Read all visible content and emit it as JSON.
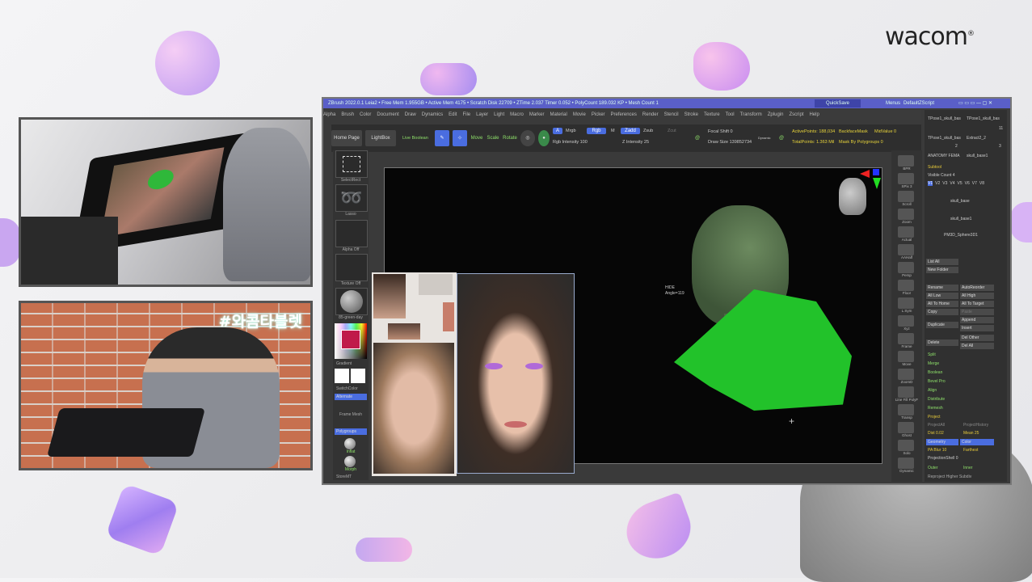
{
  "brand": {
    "name": "wacom",
    "mark": "®"
  },
  "stream": {
    "hashtag": "#와콤타블렛"
  },
  "zbrush": {
    "title": "ZBrush 2022.0.1   Leia2   • Free Mem 1.955GB • Active Mem 4175 • Scratch Disk 22709 • ZTime 2.037 Timer 0.052 • PolyCount 189.032 KP • Mesh Count 1",
    "quicksave": "QuickSave",
    "menus_label": "Menus",
    "default_script": "DefaultZScript",
    "menu": [
      "Alpha",
      "Brush",
      "Color",
      "Document",
      "Draw",
      "Dynamics",
      "Edit",
      "File",
      "Layer",
      "Light",
      "Macro",
      "Marker",
      "Material",
      "Movie",
      "Picker",
      "Preferences",
      "Render",
      "Stencil",
      "Stroke",
      "Texture",
      "Tool",
      "Transform",
      "Zplugin",
      "Zscript",
      "Help"
    ],
    "toolbar": {
      "home_page": "Home Page",
      "lightbox": "LightBox",
      "live_boolean": "Live Boolean",
      "draw": "Draw",
      "move": "Move",
      "scale": "Scale",
      "rotate": "Rotate",
      "a": "A",
      "mrgb": "Mrgb",
      "rgb": "Rgb",
      "m": "M",
      "zadd": "Zadd",
      "zsub": "Zsub",
      "zcut": "Zcut",
      "rgb_intensity": "Rgb Intensity 100",
      "z_intensity": "Z Intensity 25",
      "focal_shift": "Focal Shift 0",
      "draw_size": "Draw Size 139852734",
      "dynamic": "Dynamic",
      "active_points": "ActivePoints: 188,034",
      "total_points": "TotalPoints: 1.363 Mil",
      "backface_mask": "BackfaceMask",
      "midvalue": "MidValue 0",
      "mask_by_polygroups": "Mask By Polygroups 0"
    },
    "left_shelf": [
      "SelectRect",
      "Lasso",
      "Alpha Off",
      "Texture Off",
      "85-green-day",
      "Gradient",
      "SwitchColor",
      "Alternate",
      "Frame Mesh",
      "Polygroups",
      "Inflat",
      "Morph",
      "StoreMT"
    ],
    "canvas": {
      "hud_line1": "HIDE",
      "hud_line2": "Angle=119"
    },
    "right_shelf": [
      "BPR",
      "SPix 3",
      "Scroll",
      "Zoom",
      "Actual",
      "AAHalf",
      "Persp",
      "Floor",
      "L.Sym",
      "Xyz",
      "Frame",
      "Move",
      "ZoomD",
      "Line Fill PolyF",
      "Transp",
      "Ghost",
      "Solo",
      "Dynamic"
    ],
    "tray": {
      "tools": [
        "TPose1_skull_bas",
        "TPose1_skull_bas",
        "TPose1_skull_bas",
        "Extract2_2",
        "ANATOMY FEMA",
        "skull_base1"
      ],
      "counts": [
        "11",
        "2",
        "3"
      ],
      "subtool": "Subtool",
      "visible_count": "Visible Count 4",
      "v_tabs": [
        "V1",
        "V2",
        "V3",
        "V4",
        "V5",
        "V6",
        "V7",
        "V8"
      ],
      "subtools": [
        "skull_base",
        "skull_base1",
        "PM3D_Sphere3D1"
      ],
      "list_all": "List All",
      "new_folder": "New Folder",
      "rename": "Rename",
      "auto_reorder": "AutoReorder",
      "all_low": "All Low",
      "all_high": "All High",
      "all_to_home": "All To Home",
      "all_to_target": "All To Target",
      "copy": "Copy",
      "paste": "Paste",
      "duplicate": "Duplicate",
      "append": "Append",
      "insert": "Insert",
      "delete": "Delete",
      "del_other": "Del Other",
      "del_all": "Del All",
      "split": "Split",
      "merge": "Merge",
      "boolean": "Boolean",
      "bevel_pro": "Bevel Pro",
      "align": "Align",
      "distribute": "Distribute",
      "remesh": "Remesh",
      "project": "Project",
      "project_all": "ProjectAll",
      "project_history": "ProjectHistory",
      "dist": "Dist 0.02",
      "mean": "Mean 25",
      "geometry": "Geometry",
      "color": "Color",
      "pa_blur": "PA Blur 10",
      "farthest": "Farthest",
      "projection_shell": "ProjectionShell 0",
      "outer": "Outer",
      "inner": "Inner",
      "reproject": "Reproject Higher Subdiv"
    }
  },
  "colors": {
    "accent_blue": "#4a6de0",
    "zbrush_green": "#8ee06a",
    "zbrush_yellow": "#e6c93a",
    "mesh_green": "#22c22a"
  }
}
